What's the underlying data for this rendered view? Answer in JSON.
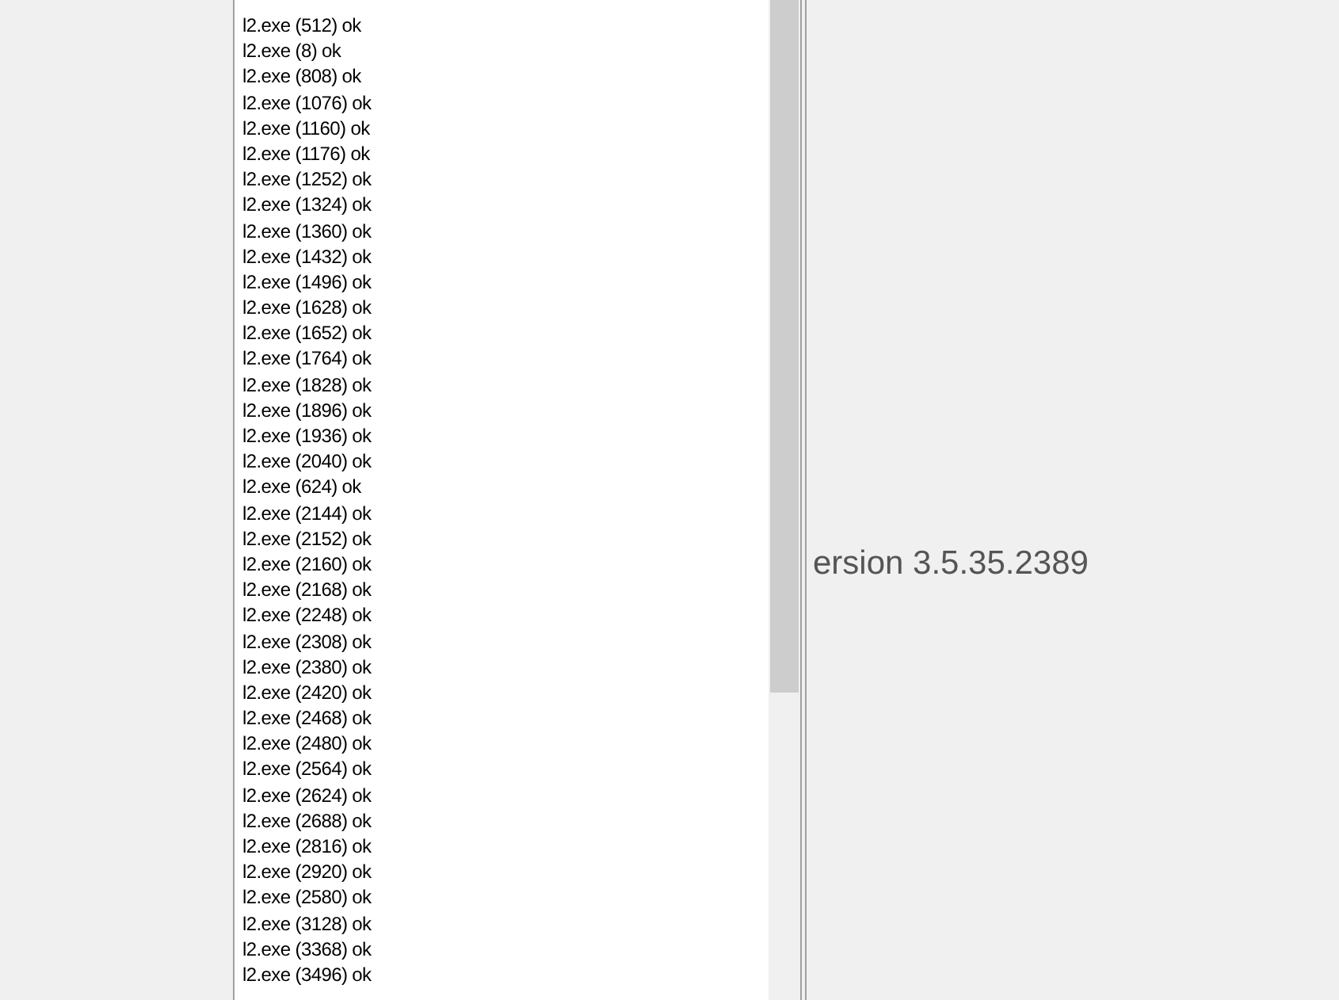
{
  "process_list": {
    "items": [
      {
        "text": "l2.exe (512) ok"
      },
      {
        "text": "l2.exe (8) ok"
      },
      {
        "text": "l2.exe (808) ok"
      },
      {
        "text": "l2.exe (1076) ok"
      },
      {
        "text": "l2.exe (1160) ok"
      },
      {
        "text": "l2.exe (1176) ok"
      },
      {
        "text": "l2.exe (1252) ok"
      },
      {
        "text": "l2.exe (1324) ok"
      },
      {
        "text": "l2.exe (1360) ok"
      },
      {
        "text": "l2.exe (1432) ok"
      },
      {
        "text": "l2.exe (1496) ok"
      },
      {
        "text": "l2.exe (1628) ok"
      },
      {
        "text": "l2.exe (1652) ok"
      },
      {
        "text": "l2.exe (1764) ok"
      },
      {
        "text": "l2.exe (1828) ok"
      },
      {
        "text": "l2.exe (1896) ok"
      },
      {
        "text": "l2.exe (1936) ok"
      },
      {
        "text": "l2.exe (2040) ok"
      },
      {
        "text": "l2.exe (624) ok"
      },
      {
        "text": "l2.exe (2144) ok"
      },
      {
        "text": "l2.exe (2152) ok"
      },
      {
        "text": "l2.exe (2160) ok"
      },
      {
        "text": "l2.exe (2168) ok"
      },
      {
        "text": "l2.exe (2248) ok"
      },
      {
        "text": "l2.exe (2308) ok"
      },
      {
        "text": "l2.exe (2380) ok"
      },
      {
        "text": "l2.exe (2420) ok"
      },
      {
        "text": "l2.exe (2468) ok"
      },
      {
        "text": "l2.exe (2480) ok"
      },
      {
        "text": "l2.exe (2564) ok"
      },
      {
        "text": "l2.exe (2624) ok"
      },
      {
        "text": "l2.exe (2688) ok"
      },
      {
        "text": "l2.exe (2816) ok"
      },
      {
        "text": "l2.exe (2920) ok"
      },
      {
        "text": "l2.exe (2580) ok"
      },
      {
        "text": "l2.exe (3128) ok"
      },
      {
        "text": "l2.exe (3368) ok"
      },
      {
        "text": "l2.exe (3496) ok"
      }
    ]
  },
  "version_label": "ersion 3.5.35.2389"
}
